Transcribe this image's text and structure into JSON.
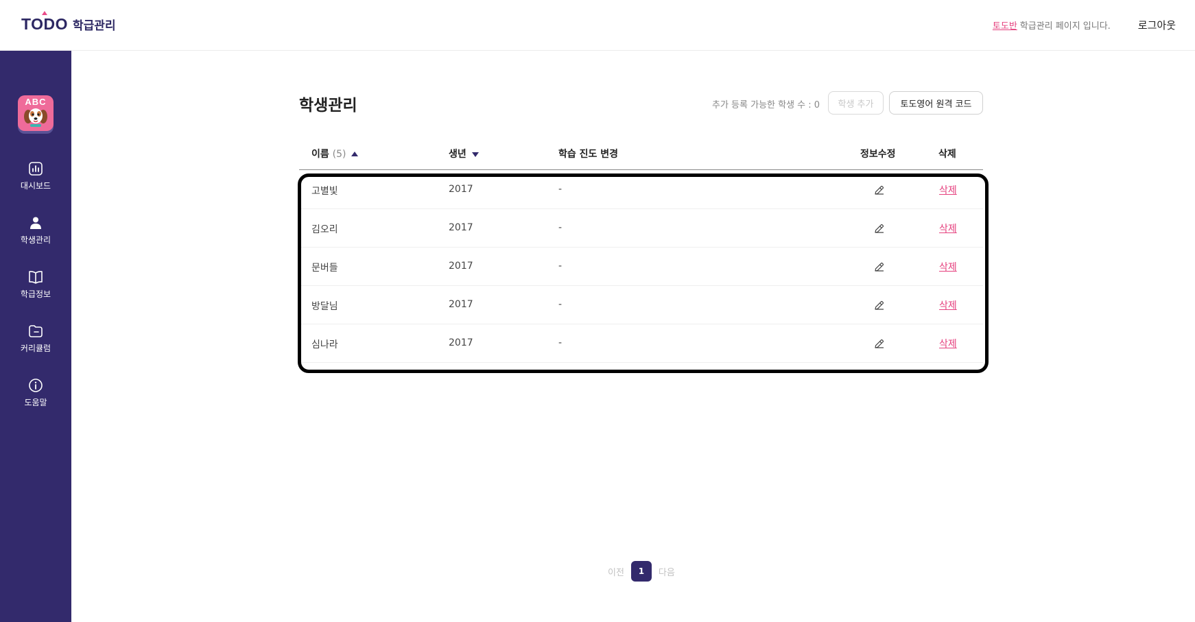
{
  "header": {
    "logo_text": "TODO",
    "logo_sub": "학급관리",
    "class_name": "토도반",
    "class_suffix": "학급관리 페이지 입니다.",
    "logout": "로그아웃"
  },
  "sidebar": {
    "avatar_text": "ABC",
    "items": [
      {
        "label": "대시보드",
        "icon": "chart-icon"
      },
      {
        "label": "학생관리",
        "icon": "person-icon"
      },
      {
        "label": "학급정보",
        "icon": "book-icon"
      },
      {
        "label": "커리큘럼",
        "icon": "folder-icon"
      },
      {
        "label": "도움말",
        "icon": "info-icon"
      }
    ]
  },
  "main": {
    "title": "학생관리",
    "available_count": "추가 등록 가능한 학생 수 : 0",
    "add_button": "학생 추가",
    "code_button": "토도영어 원격 코드",
    "columns": {
      "name": "이름",
      "name_count": "(5)",
      "birth": "생년",
      "progress": "학습 진도 변경",
      "edit": "정보수정",
      "delete": "삭제"
    },
    "rows": [
      {
        "name": "고별빛",
        "birth": "2017",
        "progress": "-",
        "delete": "삭제"
      },
      {
        "name": "김오리",
        "birth": "2017",
        "progress": "-",
        "delete": "삭제"
      },
      {
        "name": "문버들",
        "birth": "2017",
        "progress": "-",
        "delete": "삭제"
      },
      {
        "name": "방달님",
        "birth": "2017",
        "progress": "-",
        "delete": "삭제"
      },
      {
        "name": "심나라",
        "birth": "2017",
        "progress": "-",
        "delete": "삭제"
      }
    ]
  },
  "pagination": {
    "prev": "이전",
    "current": "1",
    "next": "다음"
  },
  "colors": {
    "sidebar": "#332a6c",
    "accent": "#e5407e"
  }
}
